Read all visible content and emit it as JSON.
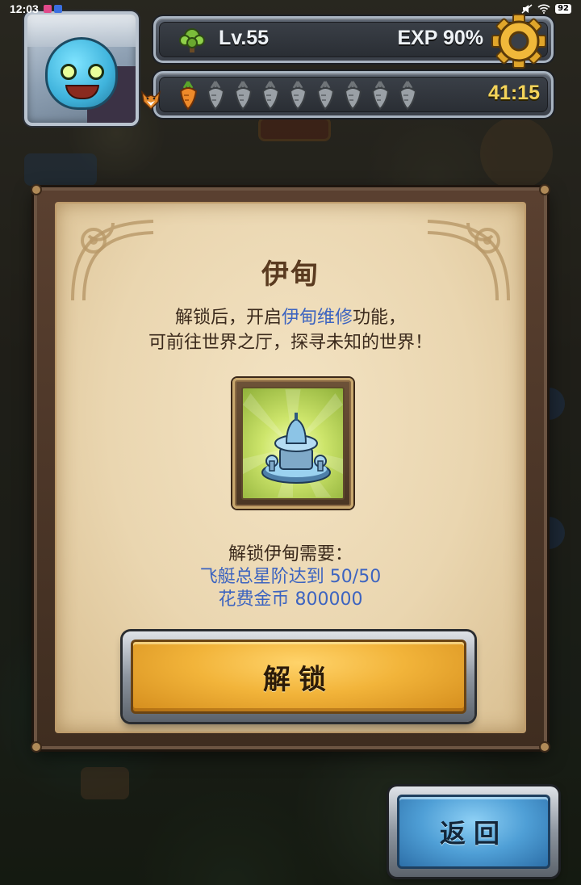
{
  "status_bar": {
    "time": "12:03",
    "battery": "92"
  },
  "hud": {
    "level_label": "Lv.55",
    "exp_label": "EXP 90%",
    "timer": "41:15",
    "stamina": {
      "filled": 1,
      "total": 9
    }
  },
  "dialog": {
    "title": "伊甸",
    "desc_part1": "解锁后，开启",
    "desc_highlight": "伊甸维修",
    "desc_part2": "功能，",
    "desc_line2": "可前往世界之厅，探寻未知的世界！",
    "requirement_title": "解锁伊甸需要：",
    "requirement_1": "飞艇总星阶达到 50/50",
    "requirement_2": "花费金币 800000",
    "unlock_label": "解锁"
  },
  "back_label": "返回",
  "colors": {
    "highlight_text": "#3d64c0",
    "unlock_button": "#f2b43a",
    "back_button": "#4f9fd6",
    "timer_text": "#f3d35a"
  }
}
